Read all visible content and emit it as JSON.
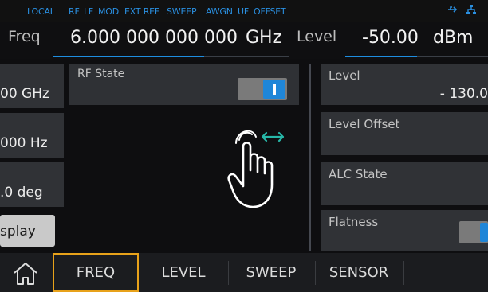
{
  "status": {
    "items": [
      "LOCAL",
      "RF",
      "LF",
      "MOD",
      "EXT REF",
      "SWEEP",
      "AWGN",
      "UF",
      "OFFSET"
    ],
    "icons": [
      "usb-icon",
      "network-icon"
    ]
  },
  "entry": {
    "freq_label": "Freq",
    "freq_value": "6.000 000 000 000",
    "freq_unit": "GHz",
    "level_label": "Level",
    "level_value": "-50.00",
    "level_unit": "dBm"
  },
  "left_column": {
    "values": [
      "00 GHz",
      "000 Hz",
      ".0 deg"
    ],
    "button_label": "splay"
  },
  "rf_state": {
    "label": "RF State",
    "on": true
  },
  "right_column": {
    "level_label": "Level",
    "level_value": "- 130.0",
    "level_offset_label": "Level Offset",
    "alc_state_label": "ALC State",
    "flatness_label": "Flatness"
  },
  "tabs": {
    "items": [
      "FREQ",
      "LEVEL",
      "SWEEP",
      "SENSOR"
    ],
    "active": "FREQ"
  },
  "colors": {
    "accent": "#1e8de0",
    "status_text": "#2a8fe0",
    "active_tab_border": "#e8a21a",
    "gesture_arrow": "#27b7a8"
  }
}
